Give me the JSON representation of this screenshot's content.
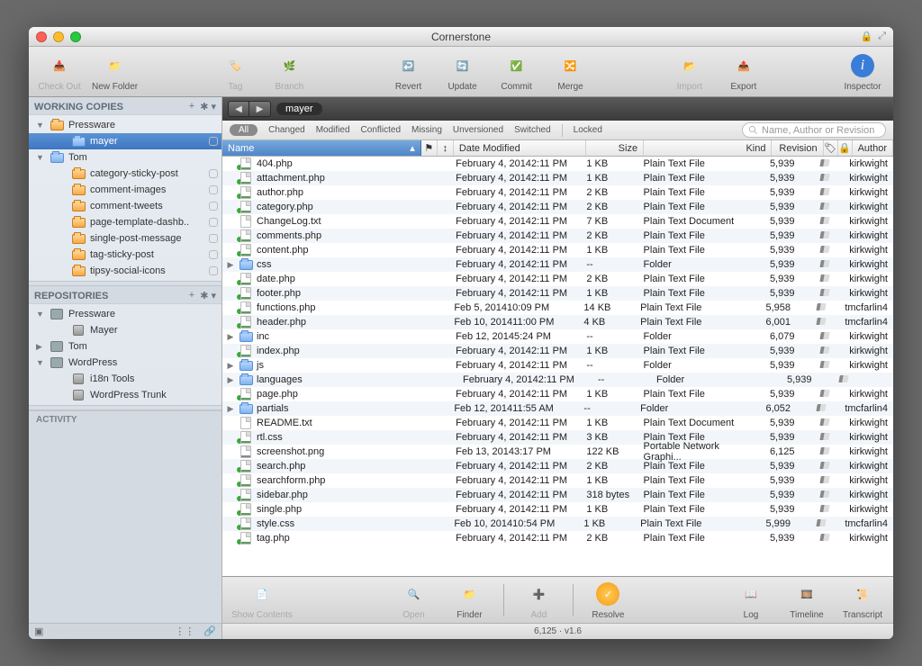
{
  "title": "Cornerstone",
  "toolbar": {
    "checkout": "Check Out",
    "newfolder": "New Folder",
    "tag": "Tag",
    "branch": "Branch",
    "revert": "Revert",
    "update": "Update",
    "commit": "Commit",
    "merge": "Merge",
    "import": "Import",
    "export": "Export",
    "inspector": "Inspector"
  },
  "sidebar": {
    "working_copies": "WORKING COPIES",
    "repositories": "REPOSITORIES",
    "activity": "ACTIVITY",
    "wc": [
      {
        "label": "Pressware",
        "depth": 1,
        "kind": "folder-orange",
        "expanded": true
      },
      {
        "label": "mayer",
        "depth": 2,
        "kind": "folder-blue",
        "selected": true,
        "pill": true
      },
      {
        "label": "Tom",
        "depth": 1,
        "kind": "folder-blue",
        "expanded": true
      },
      {
        "label": "category-sticky-post",
        "depth": 2,
        "kind": "folder-orange",
        "pill": true
      },
      {
        "label": "comment-images",
        "depth": 2,
        "kind": "folder-orange",
        "pill": true
      },
      {
        "label": "comment-tweets",
        "depth": 2,
        "kind": "folder-orange",
        "pill": true
      },
      {
        "label": "page-template-dashb..",
        "depth": 2,
        "kind": "folder-orange",
        "pill": true
      },
      {
        "label": "single-post-message",
        "depth": 2,
        "kind": "folder-orange",
        "pill": true
      },
      {
        "label": "tag-sticky-post",
        "depth": 2,
        "kind": "folder-orange",
        "pill": true
      },
      {
        "label": "tipsy-social-icons",
        "depth": 2,
        "kind": "folder-orange",
        "pill": true
      }
    ],
    "repos": [
      {
        "label": "Pressware",
        "depth": 1,
        "kind": "repo",
        "expanded": true
      },
      {
        "label": "Mayer",
        "depth": 2,
        "kind": "db"
      },
      {
        "label": "Tom",
        "depth": 1,
        "kind": "repo",
        "expanded": false
      },
      {
        "label": "WordPress",
        "depth": 1,
        "kind": "repo",
        "expanded": true
      },
      {
        "label": "i18n Tools",
        "depth": 2,
        "kind": "db"
      },
      {
        "label": "WordPress Trunk",
        "depth": 2,
        "kind": "db"
      }
    ]
  },
  "breadcrumb": "mayer",
  "filters": {
    "all": "All",
    "items": [
      "Changed",
      "Modified",
      "Conflicted",
      "Missing",
      "Unversioned",
      "Switched"
    ],
    "locked": "Locked"
  },
  "search_placeholder": "Name, Author or Revision",
  "columns": {
    "name": "Name",
    "date": "Date Modified",
    "size": "Size",
    "kind": "Kind",
    "revision": "Revision",
    "author": "Author"
  },
  "files": [
    {
      "name": "404.php",
      "type": "php",
      "mod": true,
      "date": "February 4, 2014",
      "time": "2:11 PM",
      "size": "1 KB",
      "kind": "Plain Text File",
      "rev": "5,939",
      "author": "kirkwight"
    },
    {
      "name": "attachment.php",
      "type": "php",
      "mod": true,
      "date": "February 4, 2014",
      "time": "2:11 PM",
      "size": "1 KB",
      "kind": "Plain Text File",
      "rev": "5,939",
      "author": "kirkwight"
    },
    {
      "name": "author.php",
      "type": "php",
      "mod": true,
      "date": "February 4, 2014",
      "time": "2:11 PM",
      "size": "2 KB",
      "kind": "Plain Text File",
      "rev": "5,939",
      "author": "kirkwight"
    },
    {
      "name": "category.php",
      "type": "php",
      "mod": true,
      "date": "February 4, 2014",
      "time": "2:11 PM",
      "size": "2 KB",
      "kind": "Plain Text File",
      "rev": "5,939",
      "author": "kirkwight"
    },
    {
      "name": "ChangeLog.txt",
      "type": "txt",
      "date": "February 4, 2014",
      "time": "2:11 PM",
      "size": "7 KB",
      "kind": "Plain Text Document",
      "rev": "5,939",
      "author": "kirkwight"
    },
    {
      "name": "comments.php",
      "type": "php",
      "mod": true,
      "date": "February 4, 2014",
      "time": "2:11 PM",
      "size": "2 KB",
      "kind": "Plain Text File",
      "rev": "5,939",
      "author": "kirkwight"
    },
    {
      "name": "content.php",
      "type": "php",
      "mod": true,
      "date": "February 4, 2014",
      "time": "2:11 PM",
      "size": "1 KB",
      "kind": "Plain Text File",
      "rev": "5,939",
      "author": "kirkwight"
    },
    {
      "name": "css",
      "type": "folder",
      "disc": true,
      "date": "February 4, 2014",
      "time": "2:11 PM",
      "size": "--",
      "kind": "Folder",
      "rev": "5,939",
      "author": "kirkwight"
    },
    {
      "name": "date.php",
      "type": "php",
      "mod": true,
      "date": "February 4, 2014",
      "time": "2:11 PM",
      "size": "2 KB",
      "kind": "Plain Text File",
      "rev": "5,939",
      "author": "kirkwight"
    },
    {
      "name": "footer.php",
      "type": "php",
      "mod": true,
      "date": "February 4, 2014",
      "time": "2:11 PM",
      "size": "1 KB",
      "kind": "Plain Text File",
      "rev": "5,939",
      "author": "kirkwight"
    },
    {
      "name": "functions.php",
      "type": "php",
      "mod": true,
      "date": "Feb 5, 2014",
      "time": "10:09 PM",
      "size": "14 KB",
      "kind": "Plain Text File",
      "rev": "5,958",
      "author": "tmcfarlin4"
    },
    {
      "name": "header.php",
      "type": "php",
      "mod": true,
      "date": "Feb 10, 2014",
      "time": "11:00 PM",
      "size": "4 KB",
      "kind": "Plain Text File",
      "rev": "6,001",
      "author": "tmcfarlin4"
    },
    {
      "name": "inc",
      "type": "folder",
      "disc": true,
      "date": "Feb 12, 2014",
      "time": "5:24 PM",
      "size": "--",
      "kind": "Folder",
      "rev": "6,079",
      "author": "kirkwight"
    },
    {
      "name": "index.php",
      "type": "php",
      "mod": true,
      "date": "February 4, 2014",
      "time": "2:11 PM",
      "size": "1 KB",
      "kind": "Plain Text File",
      "rev": "5,939",
      "author": "kirkwight"
    },
    {
      "name": "js",
      "type": "folder",
      "disc": true,
      "date": "February 4, 2014",
      "time": "2:11 PM",
      "size": "--",
      "kind": "Folder",
      "rev": "5,939",
      "author": "kirkwight"
    },
    {
      "name": "languages",
      "type": "folder",
      "disc": true,
      "date": "February 4, 2014",
      "time": "2:11 PM",
      "size": "--",
      "kind": "Folder",
      "rev": "5,939",
      "author": ""
    },
    {
      "name": "page.php",
      "type": "php",
      "mod": true,
      "date": "February 4, 2014",
      "time": "2:11 PM",
      "size": "1 KB",
      "kind": "Plain Text File",
      "rev": "5,939",
      "author": "kirkwight"
    },
    {
      "name": "partials",
      "type": "folder",
      "disc": true,
      "date": "Feb 12, 2014",
      "time": "11:55 AM",
      "size": "--",
      "kind": "Folder",
      "rev": "6,052",
      "author": "tmcfarlin4"
    },
    {
      "name": "README.txt",
      "type": "txt",
      "date": "February 4, 2014",
      "time": "2:11 PM",
      "size": "1 KB",
      "kind": "Plain Text Document",
      "rev": "5,939",
      "author": "kirkwight"
    },
    {
      "name": "rtl.css",
      "type": "css",
      "mod": true,
      "date": "February 4, 2014",
      "time": "2:11 PM",
      "size": "3 KB",
      "kind": "Plain Text File",
      "rev": "5,939",
      "author": "kirkwight"
    },
    {
      "name": "screenshot.png",
      "type": "img",
      "date": "Feb 13, 2014",
      "time": "3:17 PM",
      "size": "122 KB",
      "kind": "Portable Network Graphi...",
      "rev": "6,125",
      "author": "kirkwight"
    },
    {
      "name": "search.php",
      "type": "php",
      "mod": true,
      "date": "February 4, 2014",
      "time": "2:11 PM",
      "size": "2 KB",
      "kind": "Plain Text File",
      "rev": "5,939",
      "author": "kirkwight"
    },
    {
      "name": "searchform.php",
      "type": "php",
      "mod": true,
      "date": "February 4, 2014",
      "time": "2:11 PM",
      "size": "1 KB",
      "kind": "Plain Text File",
      "rev": "5,939",
      "author": "kirkwight"
    },
    {
      "name": "sidebar.php",
      "type": "php",
      "mod": true,
      "date": "February 4, 2014",
      "time": "2:11 PM",
      "size": "318 bytes",
      "kind": "Plain Text File",
      "rev": "5,939",
      "author": "kirkwight"
    },
    {
      "name": "single.php",
      "type": "php",
      "mod": true,
      "date": "February 4, 2014",
      "time": "2:11 PM",
      "size": "1 KB",
      "kind": "Plain Text File",
      "rev": "5,939",
      "author": "kirkwight"
    },
    {
      "name": "style.css",
      "type": "css",
      "mod": true,
      "date": "Feb 10, 2014",
      "time": "10:54 PM",
      "size": "1 KB",
      "kind": "Plain Text File",
      "rev": "5,999",
      "author": "tmcfarlin4"
    },
    {
      "name": "tag.php",
      "type": "php",
      "mod": true,
      "date": "February 4, 2014",
      "time": "2:11 PM",
      "size": "2 KB",
      "kind": "Plain Text File",
      "rev": "5,939",
      "author": "kirkwight"
    }
  ],
  "bottom_toolbar": {
    "show_contents": "Show Contents",
    "open": "Open",
    "finder": "Finder",
    "add": "Add",
    "resolve": "Resolve",
    "log": "Log",
    "timeline": "Timeline",
    "transcript": "Transcript"
  },
  "status": "6,125 · v1.6"
}
